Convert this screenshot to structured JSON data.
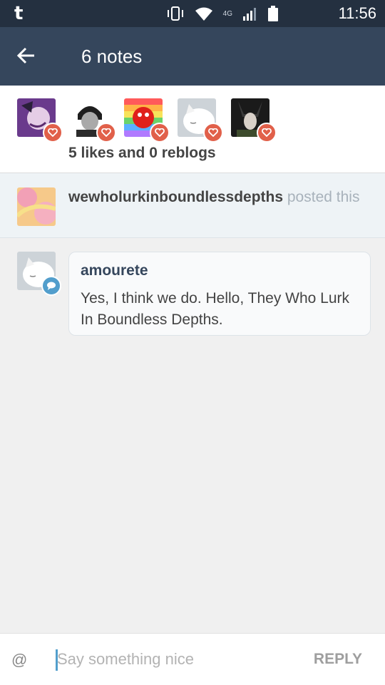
{
  "status_bar": {
    "app_icon_glyph": "t",
    "network_type": "4G",
    "roaming": "R",
    "time": "11:56",
    "icons": [
      "vibrate-icon",
      "wifi-icon",
      "signal-icon",
      "battery-icon"
    ]
  },
  "app_bar": {
    "title": "6 notes",
    "back_icon": "arrow-back-icon"
  },
  "likes": {
    "avatars": [
      {
        "name": "liker-1-avatar",
        "colors": [
          "#6a3a8c",
          "#e5cde6"
        ]
      },
      {
        "name": "liker-2-avatar",
        "colors": [
          "#ffffff",
          "#2b2b2b"
        ]
      },
      {
        "name": "liker-3-avatar",
        "colors": [
          "#ff4d4d",
          "#6ad36a"
        ]
      },
      {
        "name": "liker-4-avatar",
        "colors": [
          "#dfe3e6",
          "#ffffff"
        ]
      },
      {
        "name": "liker-5-avatar",
        "colors": [
          "#1a1a1a",
          "#3d4b2c"
        ]
      }
    ],
    "summary": "5 likes and 0 reblogs"
  },
  "posted": {
    "username": "wewholurkinboundlessdepths",
    "verb": "posted this"
  },
  "reply": {
    "username": "amourete",
    "text": "Yes, I think we do. Hello, They Who Lurk In Boundless Depths."
  },
  "composer": {
    "at_label": "@",
    "placeholder": "Say something nice",
    "reply_label": "REPLY"
  },
  "colors": {
    "status_bar": "#243040",
    "app_bar": "#35465c",
    "heart_badge": "#e1604a",
    "chat_badge": "#529ecc"
  }
}
